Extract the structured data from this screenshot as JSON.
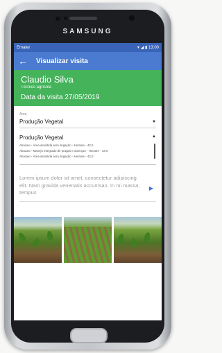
{
  "device": {
    "brand": "SAMSUNG"
  },
  "status_bar": {
    "carrier": "Emater",
    "icons": "▾ ◢ ▮",
    "time": "13:00"
  },
  "app_bar": {
    "back_icon": "←",
    "title": "Visualizar visita"
  },
  "visit_header": {
    "name": "Claudio Silva",
    "role": "Técnico agrícola",
    "date": "Data da visita 27/05/2019"
  },
  "area": {
    "label": "Área",
    "selected": "Produção Vegetal"
  },
  "production": {
    "title": "Produção Vegetal",
    "items": [
      "Abacaxi - Área assistida sem irrigação - Hectare - 43,0",
      "Abacaxi - Manejo integrado de pragas e doenças - Hectare - 43,0",
      "Abacaxi - Área assistida sem irrigação - Hectare - 43,0"
    ]
  },
  "description": {
    "text": "Lorem ipsum dolor sit amet, consectetur adipiscing elit. Nam gravida venenatis accumsan. In mi massa, tempus"
  },
  "colors": {
    "primary": "#4a7bd0",
    "status": "#3a64b8",
    "header_green": "#44b35a",
    "accent": "#3a74d8"
  },
  "icons": {
    "dropdown": "chevron-down-icon",
    "collapse": "chevron-up-icon",
    "play": "play-icon"
  }
}
